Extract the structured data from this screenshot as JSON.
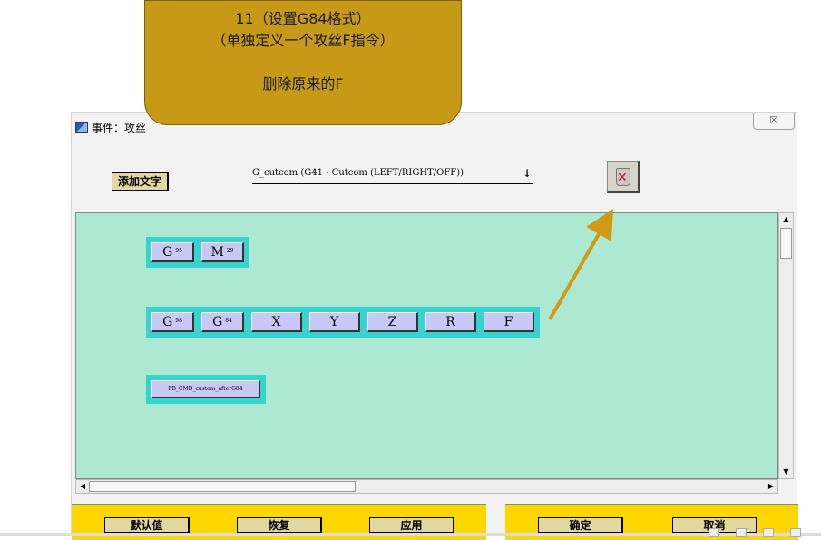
{
  "callout": {
    "line1": "11（设置G84格式）",
    "line2": "（单独定义一个攻丝F指令）",
    "line3": "删除原来的F"
  },
  "window": {
    "title": "事件：攻丝",
    "close_label": "☒"
  },
  "toolbar": {
    "add_text_label": "添加文字",
    "event_select_value": "G_cutcom (G41 - Cutcom (LEFT/RIGHT/OFF))",
    "dropdown_arrow": "↓"
  },
  "blocks": [
    {
      "words": [
        {
          "main": "G",
          "sub": "95"
        },
        {
          "main": "M",
          "sub": "29"
        }
      ]
    },
    {
      "words": [
        {
          "main": "G",
          "sub": "98"
        },
        {
          "main": "G",
          "sub": "84"
        },
        {
          "main": "X",
          "sub": ""
        },
        {
          "main": "Y",
          "sub": ""
        },
        {
          "main": "Z",
          "sub": ""
        },
        {
          "main": "R",
          "sub": ""
        },
        {
          "main": "F",
          "sub": ""
        }
      ]
    },
    {
      "words": [
        {
          "main": "PB_CMD_custom_afterG84",
          "sub": ""
        }
      ]
    }
  ],
  "buttons": {
    "default": "默认值",
    "restore": "恢复",
    "apply": "应用",
    "ok": "确定",
    "cancel": "取消"
  },
  "colors": {
    "callout": "#c69a17",
    "canvas": "#ade8d2",
    "block_row": "#37d4cf",
    "word_button": "#c8c8f4",
    "bottom_bar": "#ffd700",
    "arrow": "#d19a12"
  }
}
